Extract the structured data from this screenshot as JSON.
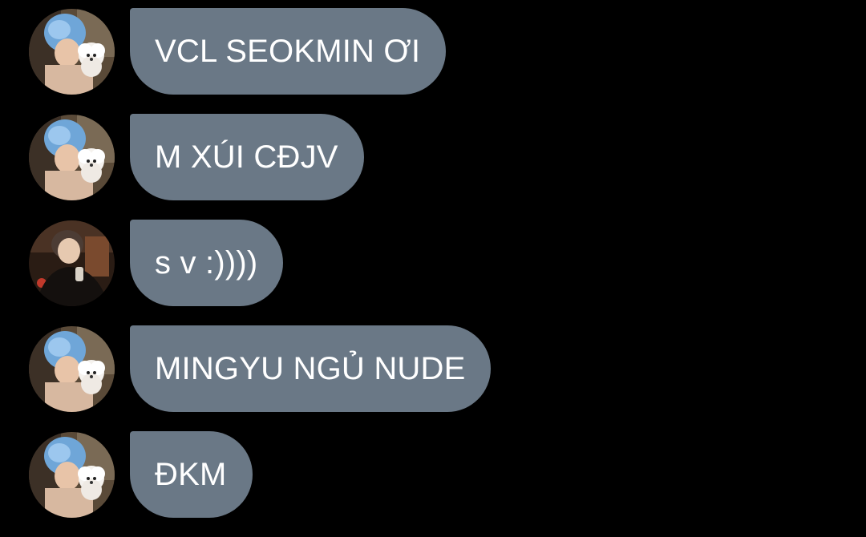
{
  "messages": [
    {
      "avatar": "avatar-blue-hair-with-dog",
      "text": "VCL SEOKMIN ƠI"
    },
    {
      "avatar": "avatar-blue-hair-with-dog",
      "text": "M XÚI CĐJV"
    },
    {
      "avatar": "avatar-dark-outfit",
      "text": "s v :))))"
    },
    {
      "avatar": "avatar-blue-hair-with-dog",
      "text": "MINGYU NGỦ NUDE"
    },
    {
      "avatar": "avatar-blue-hair-with-dog",
      "text": "ĐKM"
    }
  ],
  "colors": {
    "background": "#000000",
    "bubble": "#6a7886",
    "text": "#ffffff"
  }
}
